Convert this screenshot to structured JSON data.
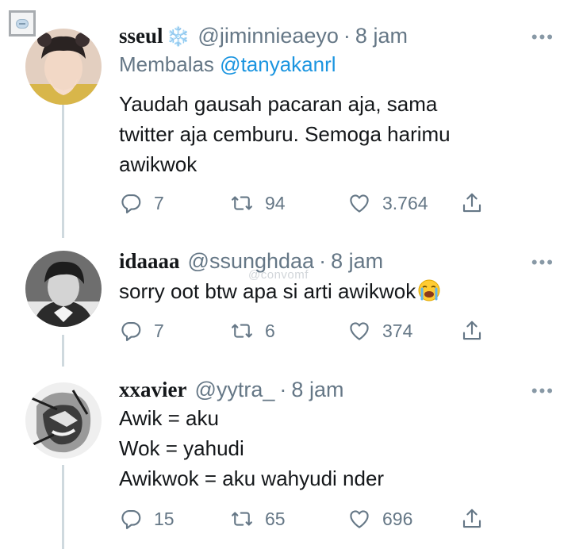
{
  "tweets": [
    {
      "name": "sseul",
      "name_emoji": "❄️",
      "handle": "@jiminnieaeyo",
      "separator": "·",
      "time": "8 jam",
      "reply_prefix": "Membalas",
      "reply_mention": "@tanyakanrl",
      "lines": [
        "Yaudah gausah pacaran aja, sama",
        "twitter aja cemburu. Semoga harimu",
        "awikwok"
      ],
      "replies": "7",
      "retweets": "94",
      "likes": "3.764"
    },
    {
      "name": "idaaaa",
      "handle": "@ssunghdaa",
      "separator": "·",
      "time": "8 jam",
      "lines": [
        "sorry oot btw apa si arti awikwok"
      ],
      "trailing_emoji": "😭",
      "replies": "7",
      "retweets": "6",
      "likes": "374"
    },
    {
      "name": "xxavier",
      "handle": "@yytra_",
      "separator": "·",
      "time": "8 jam",
      "lines": [
        "Awik = aku",
        "Wok = yahudi",
        "Awikwok = aku wahyudi nder"
      ],
      "replies": "15",
      "retweets": "65",
      "likes": "696"
    }
  ],
  "more_glyph": "•••",
  "watermark": "@convomf",
  "colors": {
    "text": "#14171a",
    "secondary": "#657786",
    "mention": "#1b95e0",
    "thread_line": "#cfd9de"
  },
  "icons": {
    "reply": "reply-icon",
    "retweet": "retweet-icon",
    "like": "like-icon",
    "share": "share-icon",
    "more": "more-options-icon"
  }
}
